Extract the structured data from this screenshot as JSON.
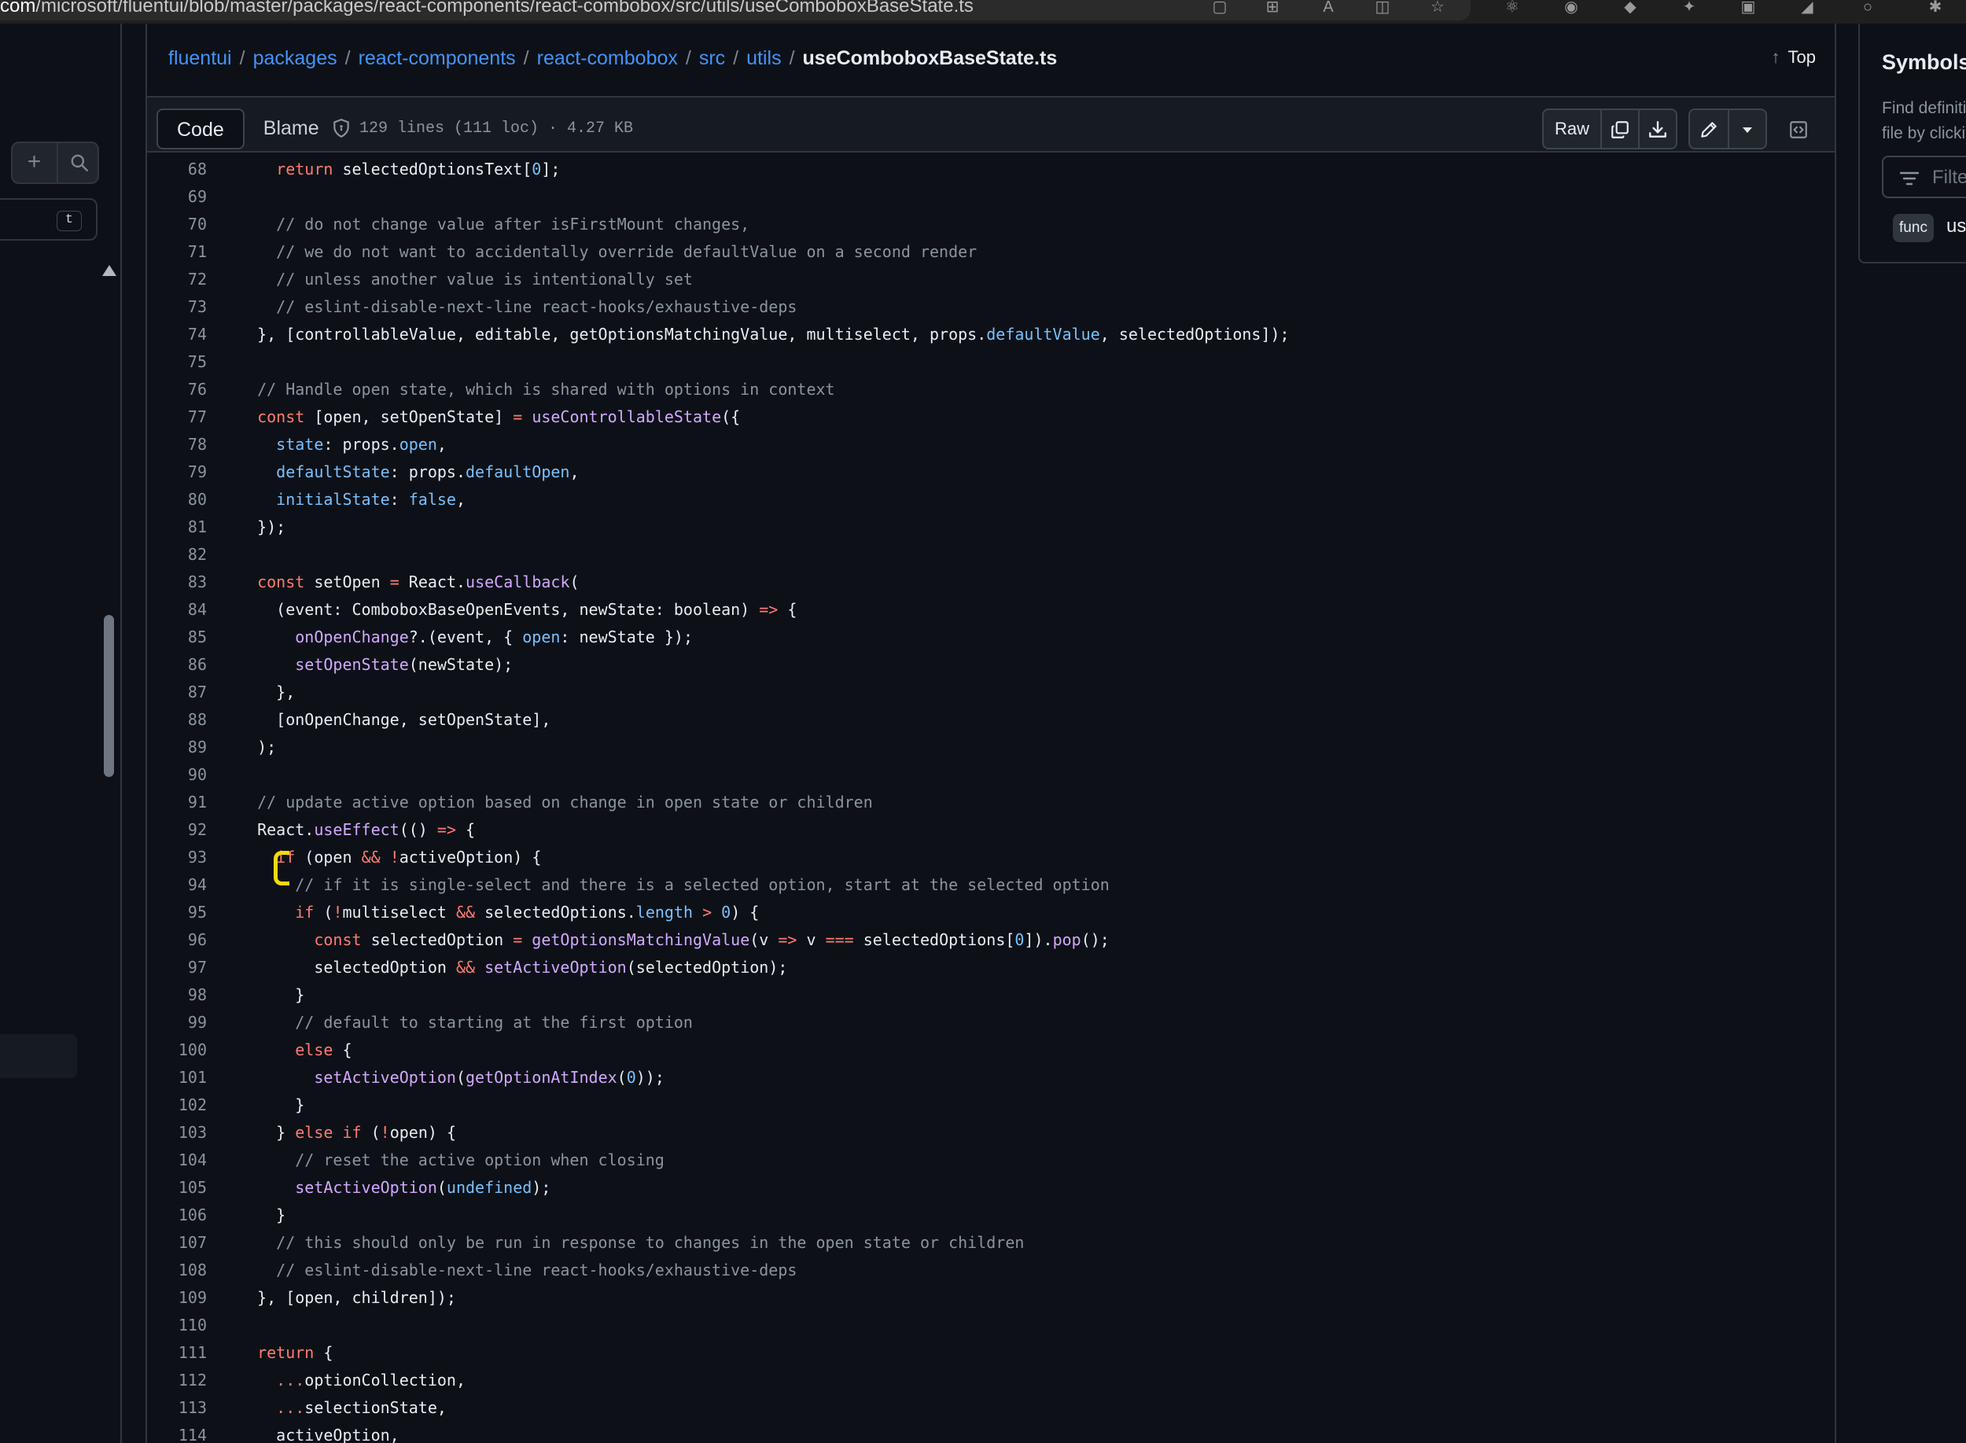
{
  "browser": {
    "url_prefix": "com",
    "url_rest": "/microsoft/fluentui/blob/master/packages/react-components/react-combobox/src/utils/useComboboxBaseState.ts",
    "icons": [
      "tab-icon",
      "grid-icon",
      "read-aloud-icon",
      "split-screen-icon",
      "favorite-icon",
      "react-devtools-icon",
      "extension-icon",
      "shield-extension-icon",
      "extension-icon-2",
      "color-extension-icon",
      "extension-icon-3",
      "circle-icon",
      "extensions-puzzle-icon"
    ]
  },
  "sidebar": {
    "add_label": "+",
    "kbd_hint": "t"
  },
  "breadcrumb": {
    "parts": [
      "fluentui",
      "packages",
      "react-components",
      "react-combobox",
      "src",
      "utils"
    ],
    "separator": "/",
    "file": "useComboboxBaseState.ts"
  },
  "top_link": "Top",
  "toolbar": {
    "code_tab": "Code",
    "blame_tab": "Blame",
    "file_info": "129 lines (111 loc) · 4.27 KB",
    "raw_label": "Raw"
  },
  "symbols": {
    "title": "Symbols",
    "hint_line1": "Find definiti",
    "hint_line2": "file by clicki",
    "filter_placeholder": "Filte",
    "badge": "func",
    "symbol_name": "us"
  },
  "code": {
    "lines": [
      {
        "n": 68,
        "tokens": [
          [
            "    ",
            ""
          ],
          [
            "return",
            "kw"
          ],
          [
            " selectedOptionsText[",
            ""
          ],
          [
            "0",
            "c"
          ],
          [
            "];",
            ""
          ]
        ]
      },
      {
        "n": 69,
        "tokens": []
      },
      {
        "n": 70,
        "tokens": [
          [
            "    // do not change value after isFirstMount changes,",
            "com"
          ]
        ]
      },
      {
        "n": 71,
        "tokens": [
          [
            "    // we do not want to accidentally override defaultValue on a second render",
            "com"
          ]
        ]
      },
      {
        "n": 72,
        "tokens": [
          [
            "    // unless another value is intentionally set",
            "com"
          ]
        ]
      },
      {
        "n": 73,
        "tokens": [
          [
            "    // eslint-disable-next-line react-hooks/exhaustive-deps",
            "com"
          ]
        ]
      },
      {
        "n": 74,
        "tokens": [
          [
            "  }, [controllableValue, editable, getOptionsMatchingValue, multiselect, props.",
            ""
          ],
          [
            "defaultValue",
            "c"
          ],
          [
            ", selectedOptions]);",
            ""
          ]
        ]
      },
      {
        "n": 75,
        "tokens": []
      },
      {
        "n": 76,
        "tokens": [
          [
            "  // Handle open state, which is shared with options in context",
            "com"
          ]
        ]
      },
      {
        "n": 77,
        "tokens": [
          [
            "  ",
            ""
          ],
          [
            "const",
            "kw"
          ],
          [
            " [open, setOpenState] ",
            ""
          ],
          [
            "=",
            "kw"
          ],
          [
            " ",
            ""
          ],
          [
            "useControllableState",
            "fn"
          ],
          [
            "({",
            ""
          ]
        ]
      },
      {
        "n": 78,
        "tokens": [
          [
            "    ",
            ""
          ],
          [
            "state",
            "c"
          ],
          [
            ": props.",
            ""
          ],
          [
            "open",
            "c"
          ],
          [
            ",",
            ""
          ]
        ]
      },
      {
        "n": 79,
        "tokens": [
          [
            "    ",
            ""
          ],
          [
            "defaultState",
            "c"
          ],
          [
            ": props.",
            ""
          ],
          [
            "defaultOpen",
            "c"
          ],
          [
            ",",
            ""
          ]
        ]
      },
      {
        "n": 80,
        "tokens": [
          [
            "    ",
            ""
          ],
          [
            "initialState",
            "c"
          ],
          [
            ": ",
            ""
          ],
          [
            "false",
            "c"
          ],
          [
            ",",
            ""
          ]
        ]
      },
      {
        "n": 81,
        "tokens": [
          [
            "  });",
            ""
          ]
        ]
      },
      {
        "n": 82,
        "tokens": []
      },
      {
        "n": 83,
        "tokens": [
          [
            "  ",
            ""
          ],
          [
            "const",
            "kw"
          ],
          [
            " setOpen ",
            ""
          ],
          [
            "=",
            "kw"
          ],
          [
            " React.",
            ""
          ],
          [
            "useCallback",
            "fn"
          ],
          [
            "(",
            ""
          ]
        ]
      },
      {
        "n": 84,
        "tokens": [
          [
            "    (event: ComboboxBaseOpenEvents, newState: boolean) ",
            ""
          ],
          [
            "=>",
            "kw"
          ],
          [
            " {",
            ""
          ]
        ]
      },
      {
        "n": 85,
        "tokens": [
          [
            "      ",
            ""
          ],
          [
            "onOpenChange",
            "fn"
          ],
          [
            "?.(event, { ",
            ""
          ],
          [
            "open",
            "c"
          ],
          [
            ": newState });",
            ""
          ]
        ]
      },
      {
        "n": 86,
        "tokens": [
          [
            "      ",
            ""
          ],
          [
            "setOpenState",
            "fn"
          ],
          [
            "(newState);",
            ""
          ]
        ]
      },
      {
        "n": 87,
        "tokens": [
          [
            "    },",
            ""
          ]
        ]
      },
      {
        "n": 88,
        "tokens": [
          [
            "    [onOpenChange, setOpenState],",
            ""
          ]
        ]
      },
      {
        "n": 89,
        "tokens": [
          [
            "  );",
            ""
          ]
        ]
      },
      {
        "n": 90,
        "tokens": []
      },
      {
        "n": 91,
        "tokens": [
          [
            "  // update active option based on change in open state or children",
            "com"
          ]
        ]
      },
      {
        "n": 92,
        "tokens": [
          [
            "  React.",
            ""
          ],
          [
            "useEffect",
            "fn"
          ],
          [
            "(() ",
            ""
          ],
          [
            "=>",
            "kw"
          ],
          [
            " {",
            ""
          ]
        ]
      },
      {
        "n": 93,
        "tokens": [
          [
            "    ",
            ""
          ],
          [
            "if",
            "kw"
          ],
          [
            " (open ",
            ""
          ],
          [
            "&&",
            "kw"
          ],
          [
            " ",
            ""
          ],
          [
            "!",
            "kw"
          ],
          [
            "activeOption) {",
            ""
          ]
        ]
      },
      {
        "n": 94,
        "tokens": [
          [
            "      // if it is single-select and there is a selected option, start at the selected option",
            "com"
          ]
        ]
      },
      {
        "n": 95,
        "tokens": [
          [
            "      ",
            ""
          ],
          [
            "if",
            "kw"
          ],
          [
            " (",
            ""
          ],
          [
            "!",
            "kw"
          ],
          [
            "multiselect ",
            ""
          ],
          [
            "&&",
            "kw"
          ],
          [
            " selectedOptions.",
            ""
          ],
          [
            "length",
            "c"
          ],
          [
            " ",
            ""
          ],
          [
            ">",
            "kw"
          ],
          [
            " ",
            ""
          ],
          [
            "0",
            "c"
          ],
          [
            ") {",
            ""
          ]
        ]
      },
      {
        "n": 96,
        "tokens": [
          [
            "        ",
            ""
          ],
          [
            "const",
            "kw"
          ],
          [
            " selectedOption ",
            ""
          ],
          [
            "=",
            "kw"
          ],
          [
            " ",
            ""
          ],
          [
            "getOptionsMatchingValue",
            "fn"
          ],
          [
            "(v ",
            ""
          ],
          [
            "=>",
            "kw"
          ],
          [
            " v ",
            ""
          ],
          [
            "===",
            "kw"
          ],
          [
            " selectedOptions[",
            ""
          ],
          [
            "0",
            "c"
          ],
          [
            "]).",
            ""
          ],
          [
            "pop",
            "fn"
          ],
          [
            "();",
            ""
          ]
        ]
      },
      {
        "n": 97,
        "tokens": [
          [
            "        selectedOption ",
            ""
          ],
          [
            "&&",
            "kw"
          ],
          [
            " ",
            ""
          ],
          [
            "setActiveOption",
            "fn"
          ],
          [
            "(selectedOption);",
            ""
          ]
        ]
      },
      {
        "n": 98,
        "tokens": [
          [
            "      }",
            ""
          ]
        ]
      },
      {
        "n": 99,
        "tokens": [
          [
            "      // default to starting at the first option",
            "com"
          ]
        ]
      },
      {
        "n": 100,
        "tokens": [
          [
            "      ",
            ""
          ],
          [
            "else",
            "kw"
          ],
          [
            " {",
            ""
          ]
        ]
      },
      {
        "n": 101,
        "tokens": [
          [
            "        ",
            ""
          ],
          [
            "setActiveOption",
            "fn"
          ],
          [
            "(",
            ""
          ],
          [
            "getOptionAtIndex",
            "fn"
          ],
          [
            "(",
            ""
          ],
          [
            "0",
            "c"
          ],
          [
            "));",
            ""
          ]
        ]
      },
      {
        "n": 102,
        "tokens": [
          [
            "      }",
            ""
          ]
        ]
      },
      {
        "n": 103,
        "tokens": [
          [
            "    } ",
            ""
          ],
          [
            "else",
            "kw"
          ],
          [
            " ",
            ""
          ],
          [
            "if",
            "kw"
          ],
          [
            " (",
            ""
          ],
          [
            "!",
            "kw"
          ],
          [
            "open) {",
            ""
          ]
        ]
      },
      {
        "n": 104,
        "tokens": [
          [
            "      // reset the active option when closing",
            "com"
          ]
        ]
      },
      {
        "n": 105,
        "tokens": [
          [
            "      ",
            ""
          ],
          [
            "setActiveOption",
            "fn"
          ],
          [
            "(",
            ""
          ],
          [
            "undefined",
            "c"
          ],
          [
            ");",
            ""
          ]
        ]
      },
      {
        "n": 106,
        "tokens": [
          [
            "    }",
            ""
          ]
        ]
      },
      {
        "n": 107,
        "tokens": [
          [
            "    // this should only be run in response to changes in the open state or children",
            "com"
          ]
        ]
      },
      {
        "n": 108,
        "tokens": [
          [
            "    // eslint-disable-next-line react-hooks/exhaustive-deps",
            "com"
          ]
        ]
      },
      {
        "n": 109,
        "tokens": [
          [
            "  }, [open, children]);",
            ""
          ]
        ]
      },
      {
        "n": 110,
        "tokens": []
      },
      {
        "n": 111,
        "tokens": [
          [
            "  ",
            ""
          ],
          [
            "return",
            "kw"
          ],
          [
            " {",
            ""
          ]
        ]
      },
      {
        "n": 112,
        "tokens": [
          [
            "    ",
            ""
          ],
          [
            "...",
            "kw"
          ],
          [
            "optionCollection,",
            ""
          ]
        ]
      },
      {
        "n": 113,
        "tokens": [
          [
            "    ",
            ""
          ],
          [
            "...",
            "kw"
          ],
          [
            "selectionState,",
            ""
          ]
        ]
      },
      {
        "n": 114,
        "tokens": [
          [
            "    activeOption,",
            ""
          ]
        ]
      }
    ]
  }
}
